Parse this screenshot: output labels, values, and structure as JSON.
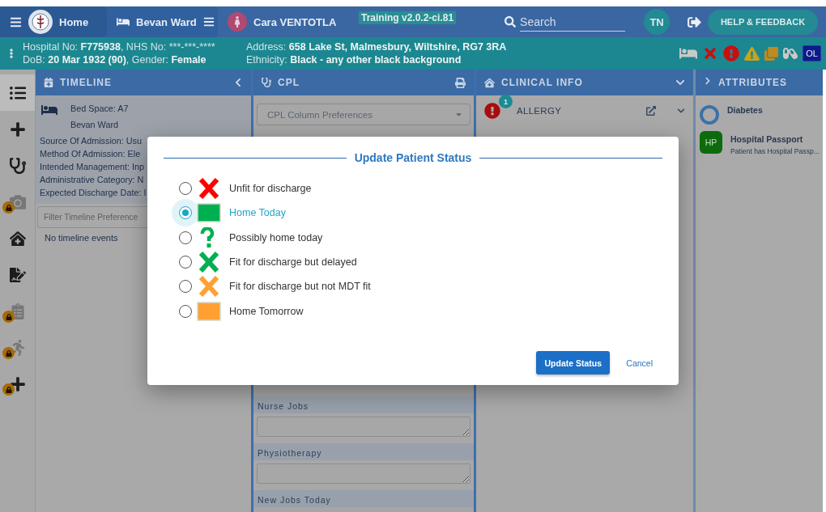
{
  "top_bar": {
    "breadcrumbs": [
      {
        "kind": "home",
        "label": "Home"
      },
      {
        "kind": "ward",
        "label": "Bevan Ward"
      },
      {
        "kind": "patient",
        "label": "Cara VENTOTLA"
      }
    ],
    "environment_badge": "Training v2.0.2-ci.81",
    "search": {
      "placeholder": "Search"
    },
    "user_initials": "TN",
    "help_button": "HELP & FEEDBACK"
  },
  "patient_banner": {
    "left_lines": [
      [
        {
          "text": "Hospital No: ",
          "bold": false
        },
        {
          "text": "F775938",
          "bold": true
        },
        {
          "text": ", NHS No: ",
          "bold": false
        },
        {
          "text": "***-***-****",
          "bold": false
        }
      ],
      [
        {
          "text": "DoB: ",
          "bold": false
        },
        {
          "text": "20 Mar 1932 (90)",
          "bold": true
        },
        {
          "text": ", Gender: ",
          "bold": false
        },
        {
          "text": "Female",
          "bold": true
        }
      ]
    ],
    "right_lines": [
      [
        {
          "text": "Address: ",
          "bold": false
        },
        {
          "text": "658 Lake St, Malmesbury, Wiltshire, RG7 3RA",
          "bold": true
        }
      ],
      [
        {
          "text": "Ethnicity: ",
          "bold": false
        },
        {
          "text": "Black - any other black background",
          "bold": true
        }
      ]
    ],
    "alert_badge": "OL"
  },
  "sidebar": {
    "items": [
      {
        "kind": "list",
        "selected": true,
        "locked": false
      },
      {
        "kind": "plus",
        "selected": false,
        "locked": false
      },
      {
        "kind": "stethoscope",
        "selected": false,
        "locked": false
      },
      {
        "kind": "camera",
        "selected": false,
        "locked": true
      },
      {
        "kind": "clinic",
        "selected": false,
        "locked": false
      },
      {
        "kind": "signature",
        "selected": false,
        "locked": false
      },
      {
        "kind": "clipboard",
        "selected": false,
        "locked": true
      },
      {
        "kind": "runner",
        "selected": false,
        "locked": true
      },
      {
        "kind": "plus",
        "selected": false,
        "locked": true
      }
    ]
  },
  "timeline": {
    "title": "TIMELINE",
    "bed_space": "Bed Space: A7",
    "ward": "Bevan Ward",
    "details": [
      "Source Of Admission: Usu",
      "Method Of Admission: Ele",
      "Intended Management: Inp",
      "Administrative Category: N",
      "Expected Discharge Date: I"
    ],
    "filter": {
      "placeholder": "Filter Timeline Preference"
    },
    "empty_text": "No timeline events"
  },
  "cpl": {
    "title": "CPL",
    "column_select": "CPL Column Preferences",
    "sections": [
      {
        "title": "Nurse Jobs",
        "has_field": true
      },
      {
        "title": "Physiotherapy",
        "has_field": true
      },
      {
        "title": "New Jobs Today",
        "has_field": false
      }
    ]
  },
  "clinical_info": {
    "title": "CLINICAL INFO",
    "items": [
      {
        "title": "ALLERGY",
        "count": "1"
      }
    ]
  },
  "attributes": {
    "title": "ATTRIBUTES",
    "items": [
      {
        "kind": "ring",
        "title": "Diabetes"
      },
      {
        "kind": "initials",
        "initials": "HP",
        "title": "Hospital Passport",
        "subtitle": "Patient has Hospital Passp..."
      }
    ]
  },
  "dialog": {
    "title": "Update Patient Status",
    "options": [
      {
        "label": "Unfit for discharge",
        "kind": "cross",
        "color": "#ff0000",
        "selected": false
      },
      {
        "label": "Home Today",
        "kind": "square",
        "color": "#00b050",
        "selected": true
      },
      {
        "label": "Possibly home today",
        "kind": "question",
        "color": "#00b050",
        "selected": false
      },
      {
        "label": "Fit for discharge but delayed",
        "kind": "cross",
        "color": "#00b050",
        "selected": false
      },
      {
        "label": "Fit for discharge but not MDT fit",
        "kind": "cross",
        "color": "#ffa033",
        "selected": false
      },
      {
        "label": "Home Tomorrow",
        "kind": "square",
        "color": "#ffa033",
        "selected": false
      }
    ],
    "buttons": {
      "primary": "Update Status",
      "secondary": "Cancel"
    }
  }
}
